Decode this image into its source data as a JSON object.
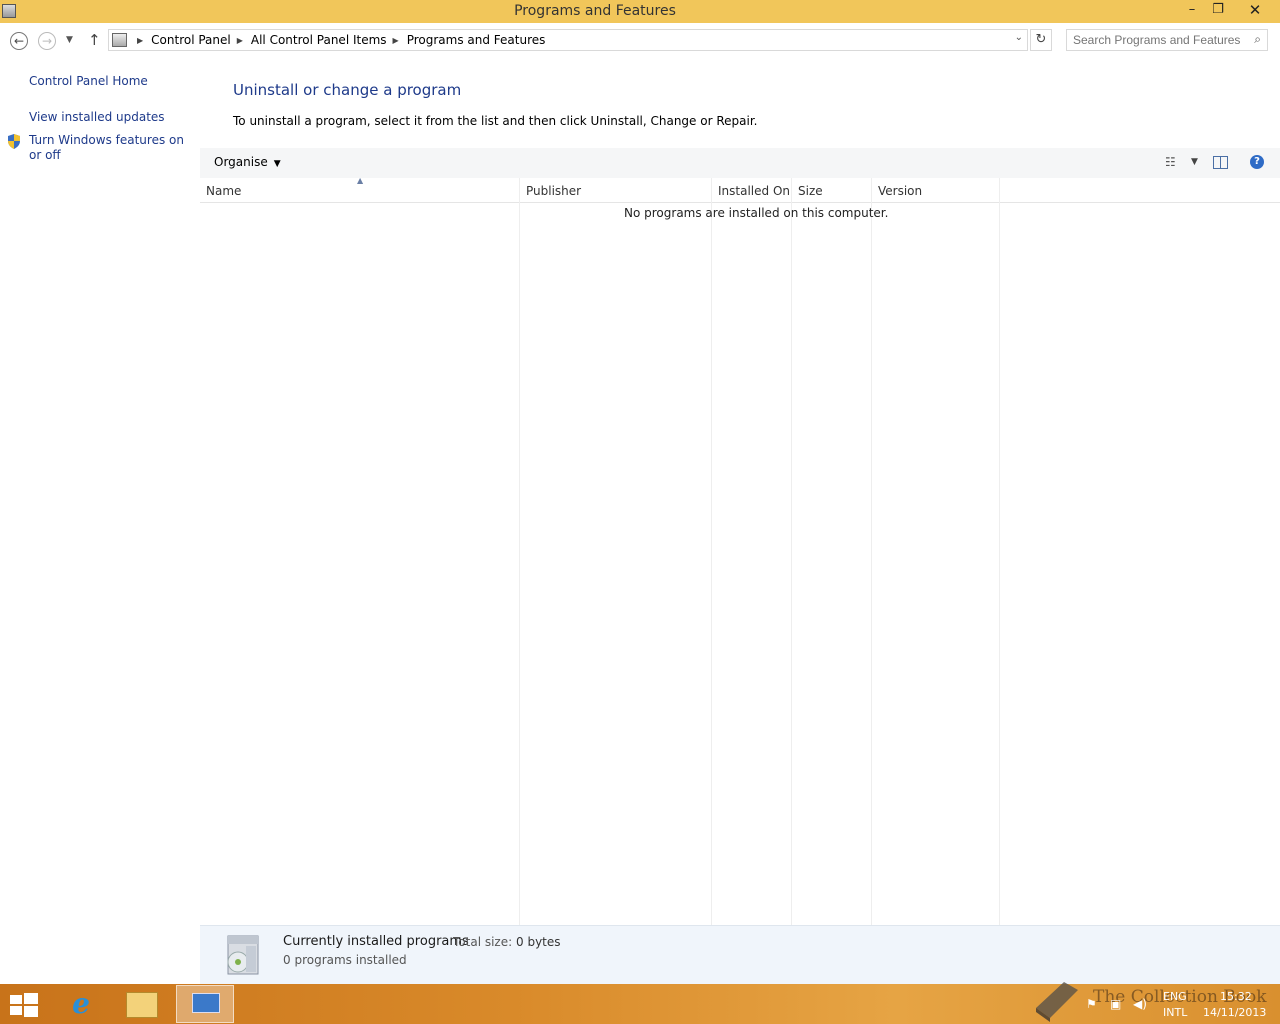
{
  "window": {
    "title": "Programs and Features",
    "minimize_glyph": "–",
    "maximize_glyph": "❐",
    "close_glyph": "✕"
  },
  "address": {
    "crumbs": [
      "Control Panel",
      "All Control Panel Items",
      "Programs and Features"
    ],
    "search_placeholder": "Search Programs and Features"
  },
  "sidebar": {
    "home": "Control Panel Home",
    "updates": "View installed updates",
    "features": "Turn Windows features on or off"
  },
  "main": {
    "heading": "Uninstall or change a program",
    "subtext": "To uninstall a program, select it from the list and then click Uninstall, Change or Repair.",
    "organise": "Organise",
    "columns": [
      "Name",
      "Publisher",
      "Installed On",
      "Size",
      "Version"
    ],
    "empty_message": "No programs are installed on this computer."
  },
  "details": {
    "title": "Currently installed programs",
    "total_size_label": "Total size:",
    "total_size_value": "0 bytes",
    "count": "0 programs installed"
  },
  "taskbar": {
    "watermark": "The Collection Book",
    "lang_top": "ENG",
    "lang_bottom": "INTL",
    "time": "15:32",
    "date": "14/11/2013"
  },
  "colors": {
    "titlebar": "#f1c65a",
    "link": "#1e3a8a",
    "taskbar": "#d98a2a"
  }
}
